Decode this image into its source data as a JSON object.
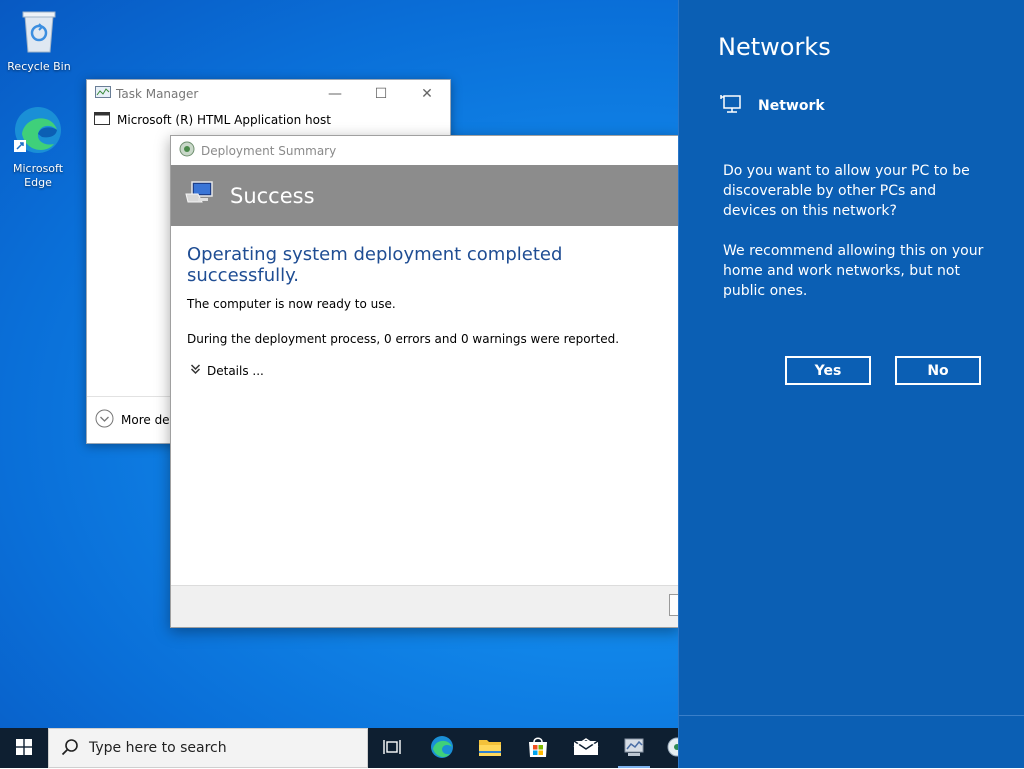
{
  "desktop": {
    "icons": [
      {
        "label": "Recycle Bin"
      },
      {
        "label": "Microsoft Edge"
      }
    ]
  },
  "task_manager": {
    "title": "Task Manager",
    "process": "Microsoft (R) HTML Application host",
    "more_details": "More deta"
  },
  "deployment": {
    "window_title": "Deployment Summary",
    "banner": "Success",
    "heading": "Operating system deployment completed successfully.",
    "line1": "The computer is now ready to use.",
    "line2": "During the deployment process, 0 errors and 0 warnings were reported.",
    "details": "Details ..."
  },
  "networks": {
    "title": "Networks",
    "network_name": "Network",
    "question": "Do you want to allow your PC to be discoverable by other PCs and devices on this network?",
    "recommendation": "We recommend allowing this on your home and work networks, but not public ones.",
    "yes": "Yes",
    "no": "No",
    "colors": {
      "panel": "#0b5fb4"
    }
  },
  "taskbar": {
    "search_placeholder": "Type here to search",
    "icons": [
      "task-view-icon",
      "edge-icon",
      "file-explorer-icon",
      "store-icon",
      "mail-icon",
      "deployment-app-icon",
      "media-icon"
    ]
  }
}
